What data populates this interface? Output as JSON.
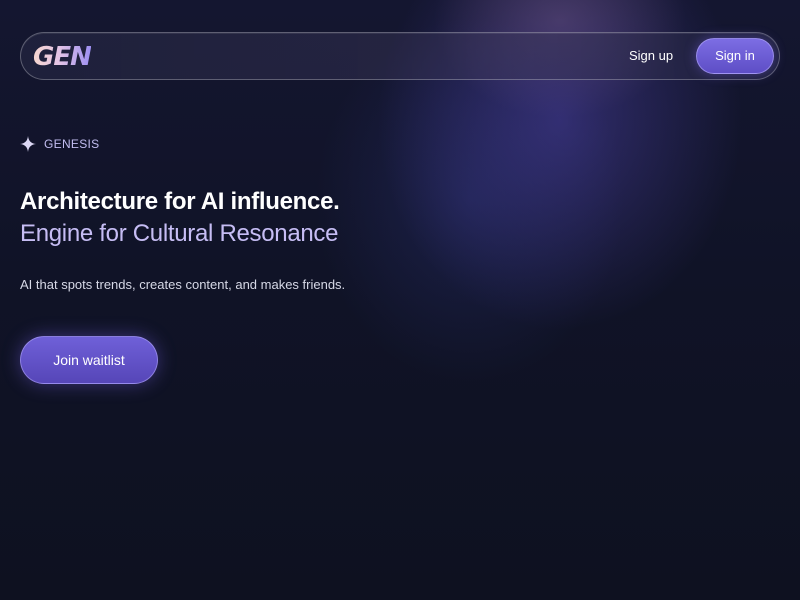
{
  "header": {
    "logo_text": "GEN",
    "signup_label": "Sign up",
    "signin_label": "Sign in"
  },
  "hero": {
    "badge_icon": "sparkle-icon",
    "badge_label": "GENESIS",
    "headline": "Architecture for AI influence.",
    "subheadline": "Engine for Cultural Resonance",
    "tagline": "AI that spots trends, creates content, and makes friends.",
    "cta_label": "Join waitlist"
  },
  "colors": {
    "background": "#101327",
    "accent": "#6f60d8",
    "subheadline": "#c6bdf4"
  }
}
